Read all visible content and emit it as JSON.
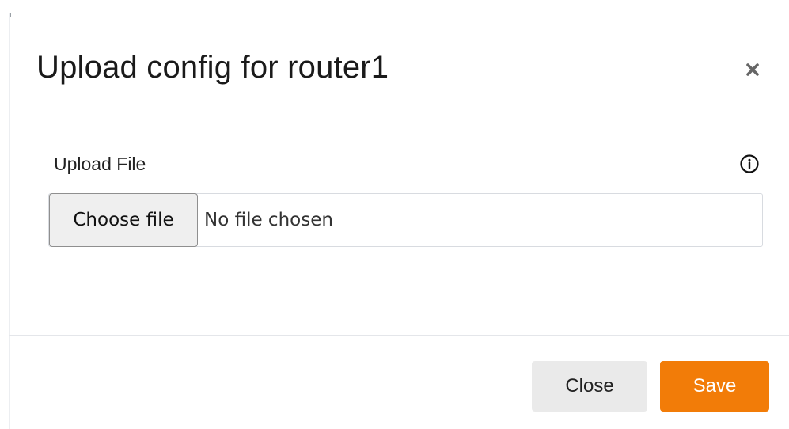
{
  "modal": {
    "title": "Upload config for router1",
    "close_icon": "close-icon"
  },
  "form": {
    "upload_label": "Upload File",
    "info_icon": "info-icon",
    "choose_button_label": "Choose file",
    "file_status": "No file chosen"
  },
  "footer": {
    "close_label": "Close",
    "save_label": "Save"
  },
  "colors": {
    "accent": "#f27c08",
    "secondary_button": "#eaeaea",
    "divider": "#e4e6ea"
  }
}
